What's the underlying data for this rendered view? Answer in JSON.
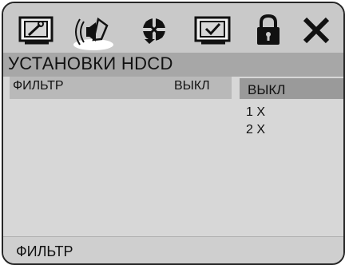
{
  "menu": {
    "tabs": [
      {
        "icon": "tools-icon"
      },
      {
        "icon": "speaker-icon"
      },
      {
        "icon": "video-icon"
      },
      {
        "icon": "tv-check-icon"
      },
      {
        "icon": "lock-icon"
      },
      {
        "icon": "close-icon"
      }
    ]
  },
  "page": {
    "title": "УСТАНОВКИ HDCD"
  },
  "settings": {
    "rows": [
      {
        "label": "ФИЛЬТР",
        "value": "ВЫКЛ"
      }
    ]
  },
  "options": [
    {
      "label": "ВЫКЛ",
      "selected": true
    },
    {
      "label": "1 X",
      "selected": false
    },
    {
      "label": "2 X",
      "selected": false
    }
  ],
  "status": {
    "text": "ФИЛЬТР"
  },
  "colors": {
    "frame_border": "#262626",
    "title_bar": "#a7a7a7",
    "selected_option": "#9a9a9a"
  }
}
